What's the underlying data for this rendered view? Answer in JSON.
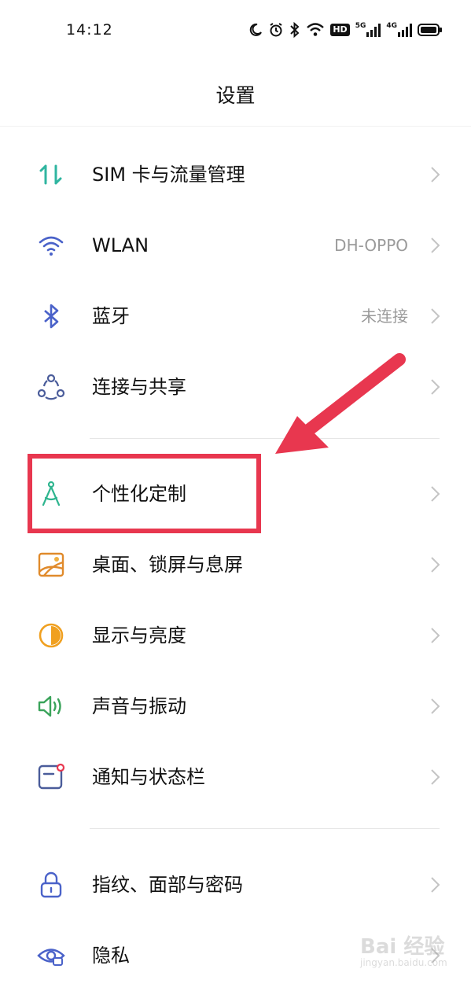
{
  "status_bar": {
    "time": "14:12",
    "icons": [
      "moon-icon",
      "alarm-icon",
      "bluetooth-icon",
      "wifi-icon",
      "hd-icon",
      "signal-5g-icon",
      "signal-4g-icon",
      "battery-icon"
    ],
    "hd_label": "HD",
    "sim1_label": "5G",
    "sim2_label": "4G"
  },
  "header": {
    "title": "设置"
  },
  "sections": [
    {
      "items": [
        {
          "label": "SIM 卡与流量管理",
          "value": "",
          "icon": "sim-data-icon"
        },
        {
          "label": "WLAN",
          "value": "DH-OPPO",
          "icon": "wlan-icon"
        },
        {
          "label": "蓝牙",
          "value": "未连接",
          "icon": "bluetooth-icon"
        },
        {
          "label": "连接与共享",
          "value": "",
          "icon": "connection-sharing-icon"
        }
      ]
    },
    {
      "items": [
        {
          "label": "个性化定制",
          "value": "",
          "icon": "personalization-icon"
        },
        {
          "label": "桌面、锁屏与息屏",
          "value": "",
          "icon": "wallpaper-icon"
        },
        {
          "label": "显示与亮度",
          "value": "",
          "icon": "display-brightness-icon"
        },
        {
          "label": "声音与振动",
          "value": "",
          "icon": "sound-icon"
        },
        {
          "label": "通知与状态栏",
          "value": "",
          "icon": "notification-icon"
        }
      ]
    },
    {
      "items": [
        {
          "label": "指纹、面部与密码",
          "value": "",
          "icon": "lock-icon"
        },
        {
          "label": "隐私",
          "value": "",
          "icon": "privacy-icon"
        }
      ]
    }
  ],
  "annotation": {
    "highlighted_item": "个性化定制",
    "color": "#e8374f"
  },
  "watermark": {
    "brand": "Bai 经验",
    "url": "jingyan.baidu.com"
  },
  "colors": {
    "sim": "#2fb5a0",
    "wlan": "#4a62c9",
    "bluetooth": "#4a62c9",
    "personalization": "#2fb58f",
    "wallpaper": "#e08a2b",
    "display": "#f0a020",
    "sound": "#3aa35a",
    "notification": "#4a5c9a",
    "lock": "#4a62c9"
  }
}
